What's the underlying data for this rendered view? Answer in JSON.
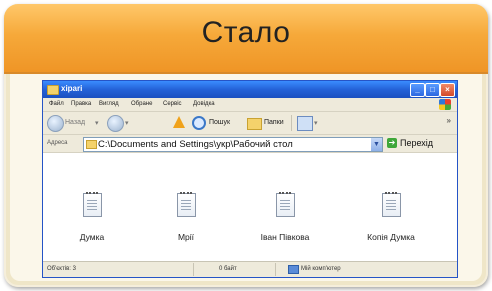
{
  "card": {
    "title": "Стало"
  },
  "window": {
    "title": "xipari",
    "menu": [
      "Файл",
      "Правка",
      "Вигляд",
      "Обране",
      "Сервіс",
      "Довідка"
    ],
    "toolbar": {
      "back": "Назад",
      "search": "Пошук",
      "folders": "Папки",
      "more": "»"
    },
    "address": {
      "label": "Адреса",
      "value": "C:\\Documents and Settings\\укр\\Рабочий стол",
      "go": "Перехід"
    },
    "files": [
      {
        "name": "Думка"
      },
      {
        "name": "Мрії"
      },
      {
        "name": "Іван Півкова"
      },
      {
        "name": "Копія Думка"
      }
    ],
    "status": {
      "objects": "Об'єктів: 3",
      "size": "0 байт",
      "location": "Мій комп'ютер"
    }
  }
}
